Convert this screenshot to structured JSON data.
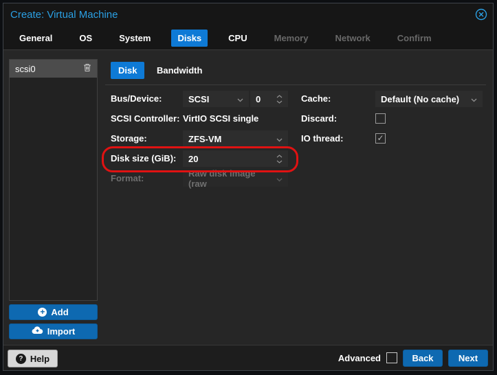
{
  "window": {
    "title": "Create: Virtual Machine"
  },
  "wizard_tabs": [
    {
      "label": "General",
      "state": "enabled"
    },
    {
      "label": "OS",
      "state": "enabled"
    },
    {
      "label": "System",
      "state": "enabled"
    },
    {
      "label": "Disks",
      "state": "active"
    },
    {
      "label": "CPU",
      "state": "enabled"
    },
    {
      "label": "Memory",
      "state": "disabled"
    },
    {
      "label": "Network",
      "state": "disabled"
    },
    {
      "label": "Confirm",
      "state": "disabled"
    }
  ],
  "disk_panel": {
    "items": [
      {
        "label": "scsi0",
        "selected": true
      }
    ],
    "add_label": "Add",
    "import_label": "Import"
  },
  "subtabs": [
    {
      "label": "Disk",
      "active": true
    },
    {
      "label": "Bandwidth",
      "active": false
    }
  ],
  "form": {
    "left": [
      {
        "label": "Bus/Device:",
        "combo_value": "SCSI",
        "number_value": "0"
      },
      {
        "label": "SCSI Controller:",
        "value": "VirtIO SCSI single"
      },
      {
        "label": "Storage:",
        "value": "ZFS-VM"
      },
      {
        "label": "Disk size (GiB):",
        "value": "20",
        "highlighted": true
      },
      {
        "label": "Format:",
        "value": "Raw disk image (raw",
        "disabled": true
      }
    ],
    "right": [
      {
        "label": "Cache:",
        "value": "Default (No cache)"
      },
      {
        "label": "Discard:",
        "checked": false
      },
      {
        "label": "IO thread:",
        "checked": true,
        "check_glyph": "✓"
      }
    ]
  },
  "footer": {
    "help_label": "Help",
    "advanced_label": "Advanced",
    "advanced_checked": false,
    "back_label": "Back",
    "next_label": "Next"
  },
  "icons": {
    "plus_glyph": "+",
    "question_glyph": "?"
  },
  "colors": {
    "accent_blue": "#0e7ad6",
    "button_blue": "#0e69b1",
    "title_blue": "#2ba0e4",
    "annotation_red": "#e01212",
    "dialog_bg": "#262626",
    "header_bg": "#161616",
    "selected_row_bg": "#4c4c4c"
  }
}
